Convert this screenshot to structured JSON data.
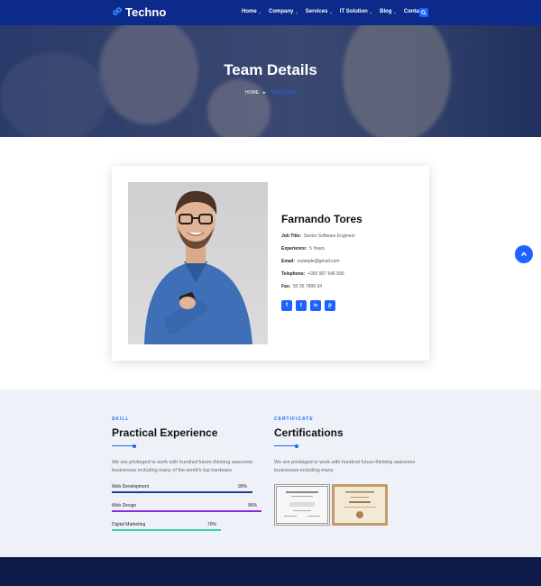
{
  "brand": {
    "name": "Techno"
  },
  "nav": {
    "items": [
      {
        "label": "Home"
      },
      {
        "label": "Company"
      },
      {
        "label": "Services"
      },
      {
        "label": "IT Solution"
      },
      {
        "label": "Blog"
      },
      {
        "label": "Contact"
      }
    ],
    "caret": "⌄"
  },
  "hero": {
    "title": "Team Details",
    "breadcrumb": {
      "home": "HOME",
      "separator": "▸",
      "current": "Team Details"
    }
  },
  "profile": {
    "name": "Farnando Tores",
    "fields": {
      "job_title_label": "Job Title:",
      "job_title_value": "Senior Software Engineer",
      "experience_label": "Experience:",
      "experience_value": "5 Years",
      "email_label": "Email:",
      "email_value": "example@gmail.com",
      "telephone_label": "Telephone:",
      "telephone_value": "+000 907 546 090",
      "fax_label": "Fax:",
      "fax_value": "55 56 7899 34"
    },
    "socials": [
      {
        "icon": "facebook-icon",
        "glyph": "f"
      },
      {
        "icon": "twitter-icon",
        "glyph": "t"
      },
      {
        "icon": "linkedin-icon",
        "glyph": "in"
      },
      {
        "icon": "pinterest-icon",
        "glyph": "p"
      }
    ]
  },
  "skills_section": {
    "eyebrow": "SKILL",
    "heading": "Practical Experience",
    "text": "We are privileged to work with hundred future-thinking awesome businesses including many of the world's top hardware",
    "skills": [
      {
        "name": "Web Development",
        "value": "90%",
        "percent": 90,
        "color": "#1e3a9a"
      },
      {
        "name": "Web Design",
        "value": "96%",
        "percent": 96,
        "color": "#8a2be2"
      },
      {
        "name": "Digital Marketing",
        "value": "70%",
        "percent": 70,
        "color": "#2ed3a8"
      }
    ]
  },
  "certs_section": {
    "eyebrow": "CERTIFICATE",
    "heading": "Certifications",
    "text": "We are privileged to work with hundred future-thinking awesome businesses including many"
  },
  "colors": {
    "primary": "#1e63ff",
    "header": "#0b2a8a",
    "footer": "#0d1b4a",
    "section_bg": "#eef2f8"
  }
}
